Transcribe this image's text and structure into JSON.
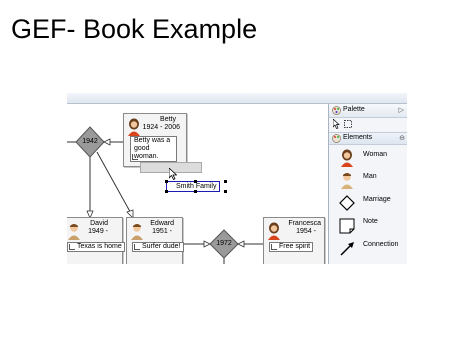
{
  "slide": {
    "title": "GEF- Book Example"
  },
  "people": [
    {
      "name": "Betty",
      "years": "1924 - 2006",
      "note_line1": "Betty was a",
      "note_line2": "good woman.",
      "gender": "female"
    },
    {
      "name": "David",
      "years": "1949 -",
      "note": "Texas is home",
      "gender": "male"
    },
    {
      "name": "Edward",
      "years": "1951 -",
      "note": "Surfer dude!",
      "gender": "male"
    },
    {
      "name": "Francesca",
      "years": "1954 -",
      "note": "Free spirit",
      "gender": "female"
    }
  ],
  "marriages": [
    {
      "year": "1942"
    },
    {
      "year": "1972"
    }
  ],
  "selected_note": {
    "text": "Smith Family"
  },
  "palette": {
    "title": "Palette",
    "drawer_title": "Elements",
    "items": [
      {
        "label": "Woman",
        "icon": "woman-icon"
      },
      {
        "label": "Man",
        "icon": "man-icon"
      },
      {
        "label": "Marriage",
        "icon": "diamond-icon"
      },
      {
        "label": "Note",
        "icon": "note-icon"
      },
      {
        "label": "Connection",
        "icon": "arrow-icon"
      }
    ]
  }
}
